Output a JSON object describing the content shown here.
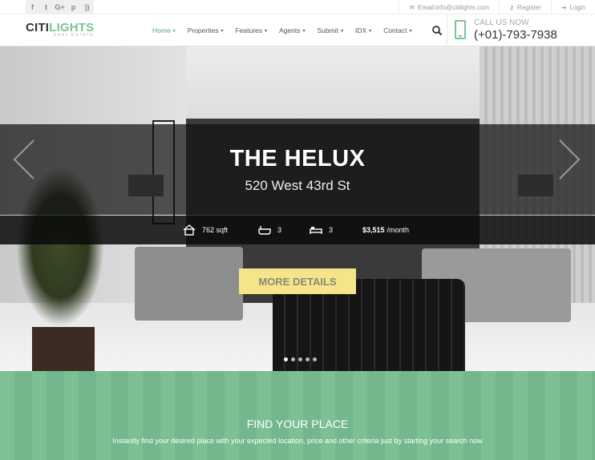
{
  "social": {
    "icons": [
      "facebook-icon",
      "twitter-icon",
      "google-plus-icon",
      "pinterest-icon",
      "rss-icon"
    ]
  },
  "topbar": {
    "email": "Email:info@citilights.com",
    "register": "Register",
    "login": "Login"
  },
  "logo": {
    "primary": "CITI",
    "accent": "LIGHTS",
    "tagline": "REAL ESTATE"
  },
  "nav": {
    "items": [
      {
        "label": "Home",
        "active": true
      },
      {
        "label": "Properties"
      },
      {
        "label": "Features"
      },
      {
        "label": "Agents"
      },
      {
        "label": "Submit"
      },
      {
        "label": "IDX"
      },
      {
        "label": "Contact"
      }
    ]
  },
  "call": {
    "label": "CALL US NOW",
    "number": "(+01)-793-7938"
  },
  "hero": {
    "title": "THE HELUX",
    "address": "520 West 43rd St",
    "area": "762 sqft",
    "baths": "3",
    "beds": "3",
    "price": "$3,515",
    "price_unit": "/month",
    "button": "MORE DETAILS",
    "slides": 5,
    "active_slide": 1
  },
  "find": {
    "title": "FIND YOUR PLACE",
    "description": "Instantly find your desired place with your expected location, price and other criteria just by starting your search now"
  },
  "colors": {
    "accent": "#7cc197",
    "find_bg": "#78bd90",
    "button": "#f4e58a"
  }
}
